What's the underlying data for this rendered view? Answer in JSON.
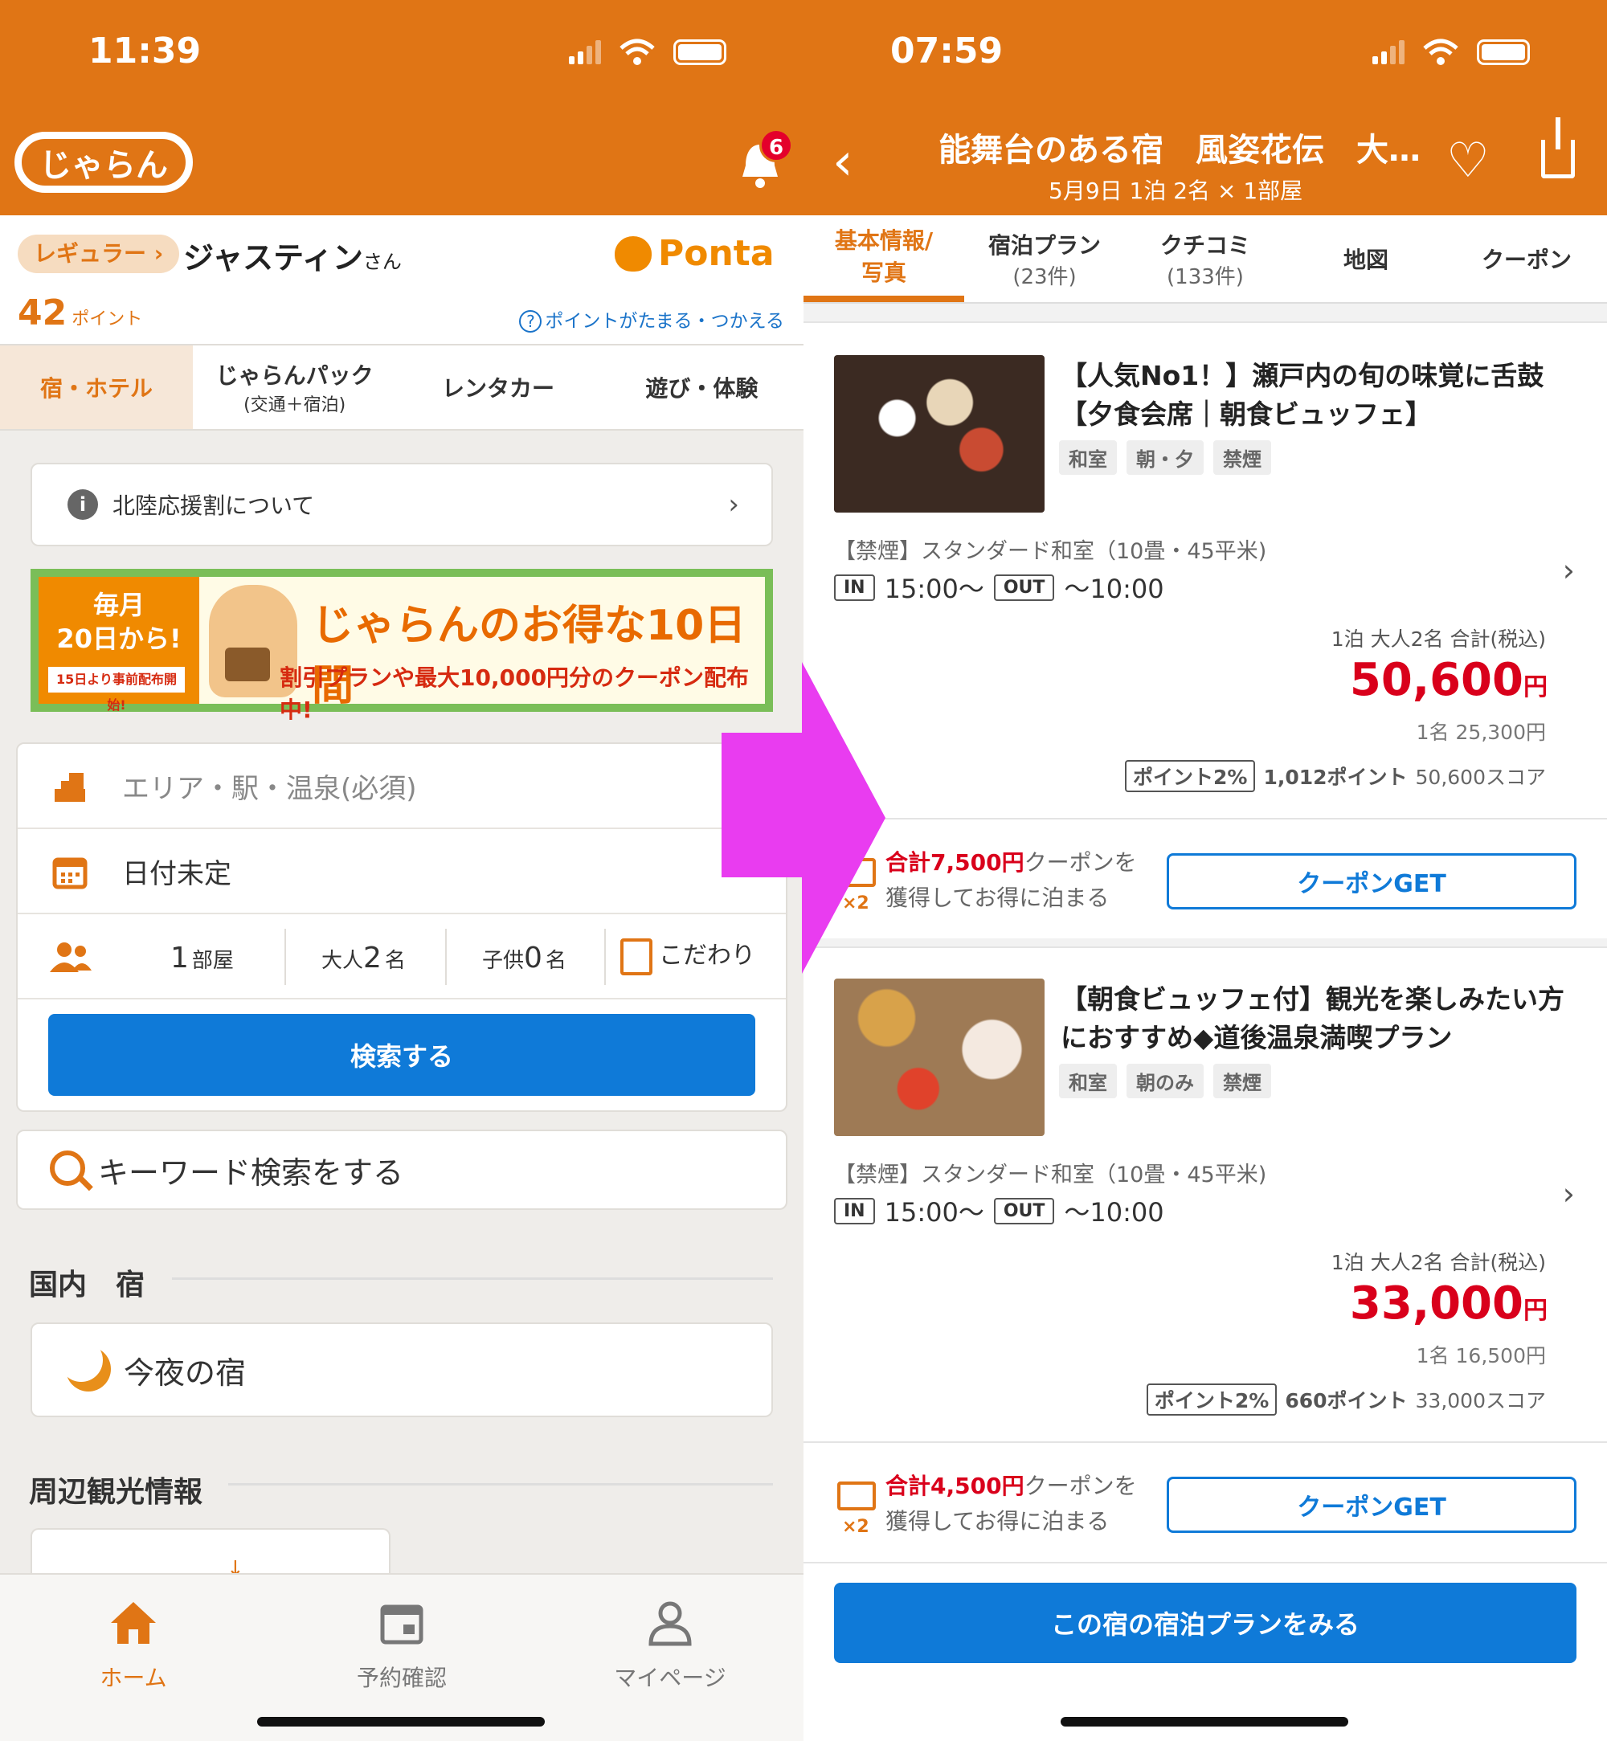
{
  "left": {
    "status": {
      "time": "11:39"
    },
    "header": {
      "logo_text": "じゃらん",
      "notification_count": "6"
    },
    "member": {
      "rank": "レギュラー ›",
      "name": "ジャスティン",
      "suffix": "さん",
      "ponta": "Ponta",
      "points_value": "42",
      "points_unit": "ポイント",
      "points_help": "ポイントがたまる・つかえる"
    },
    "tabs": [
      {
        "label": "宿・ホテル",
        "sub": ""
      },
      {
        "label": "じゃらんパック",
        "sub": "(交通＋宿泊)"
      },
      {
        "label": "レンタカー",
        "sub": ""
      },
      {
        "label": "遊び・体験",
        "sub": ""
      }
    ],
    "notice": "北陸応援割について",
    "banner": {
      "left_top": "毎月",
      "left_mid": "20日から!",
      "strip": "15日より事前配布開始!",
      "headline": "じゃらんのお得な10日間",
      "subline": "割引プランや最大10,000円分のクーポン配布中!"
    },
    "search": {
      "area_placeholder": "エリア・駅・温泉(必須)",
      "date": "日付未定",
      "rooms_value": "1",
      "rooms_unit": "部屋",
      "adults_label": "大人",
      "adults_value": "2",
      "adults_unit": "名",
      "children_label": "子供",
      "children_value": "0",
      "children_unit": "名",
      "kodawari": "こだわり",
      "button": "検索する"
    },
    "keyword": "キーワード検索をする",
    "section_domestic": "国内　宿",
    "tonight": "今夜の宿",
    "section_sightseeing": "周辺観光情報",
    "nav": [
      {
        "label": "ホーム",
        "icon": "home-icon",
        "active": true
      },
      {
        "label": "予約確認",
        "icon": "calendar-icon",
        "active": false
      },
      {
        "label": "マイページ",
        "icon": "person-icon",
        "active": false
      }
    ]
  },
  "right": {
    "status": {
      "time": "07:59"
    },
    "header": {
      "title": "能舞台のある宿　風姿花伝　大…",
      "subtitle": "5月9日 1泊 2名 × 1部屋"
    },
    "tabs": [
      {
        "label": "基本情報/",
        "sub": "写真"
      },
      {
        "label": "宿泊プラン",
        "sub": "(23件)"
      },
      {
        "label": "クチコミ",
        "sub": "(133件)"
      },
      {
        "label": "地図",
        "sub": ""
      },
      {
        "label": "クーポン",
        "sub": ""
      }
    ],
    "plans": [
      {
        "title": "【人気No1！】瀬戸内の旬の味覚に舌鼓【夕食会席｜朝食ビュッフェ】",
        "tags": [
          "和室",
          "朝・夕",
          "禁煙"
        ],
        "room": "【禁煙】スタンダード和室（10畳・45平米)",
        "checkin": "15:00〜",
        "checkout": "〜10:00",
        "price_caption": "1泊 大人2名 合計(税込)",
        "price": "50,600",
        "price_unit": "円",
        "per_person": "1名 25,300円",
        "point_rate": "ポイント2%",
        "points": "1,012ポイント",
        "score": "50,600スコア",
        "coupon_amount": "合計7,500円",
        "coupon_text1": "クーポンを",
        "coupon_text2": "獲得してお得に泊まる",
        "coupon_button": "クーポンGET"
      },
      {
        "title": "【朝食ビュッフェ付】観光を楽しみたい方におすすめ◆道後温泉満喫プラン",
        "tags": [
          "和室",
          "朝のみ",
          "禁煙"
        ],
        "room": "【禁煙】スタンダード和室（10畳・45平米)",
        "checkin": "15:00〜",
        "checkout": "〜10:00",
        "price_caption": "1泊 大人2名 合計(税込)",
        "price": "33,000",
        "price_unit": "円",
        "per_person": "1名 16,500円",
        "point_rate": "ポイント2%",
        "points": "660ポイント",
        "score": "33,000スコア",
        "coupon_amount": "合計4,500円",
        "coupon_text1": "クーポンを",
        "coupon_text2": "獲得してお得に泊まる",
        "coupon_button": "クーポンGET"
      }
    ],
    "in_label": "IN",
    "out_label": "OUT",
    "x2": "×2",
    "cta": "この宿の宿泊プランをみる"
  },
  "colors": {
    "brand": "#e07515",
    "accent_blue": "#0f7ad8",
    "price_red": "#d9001b",
    "arrow": "#e93cf0"
  }
}
